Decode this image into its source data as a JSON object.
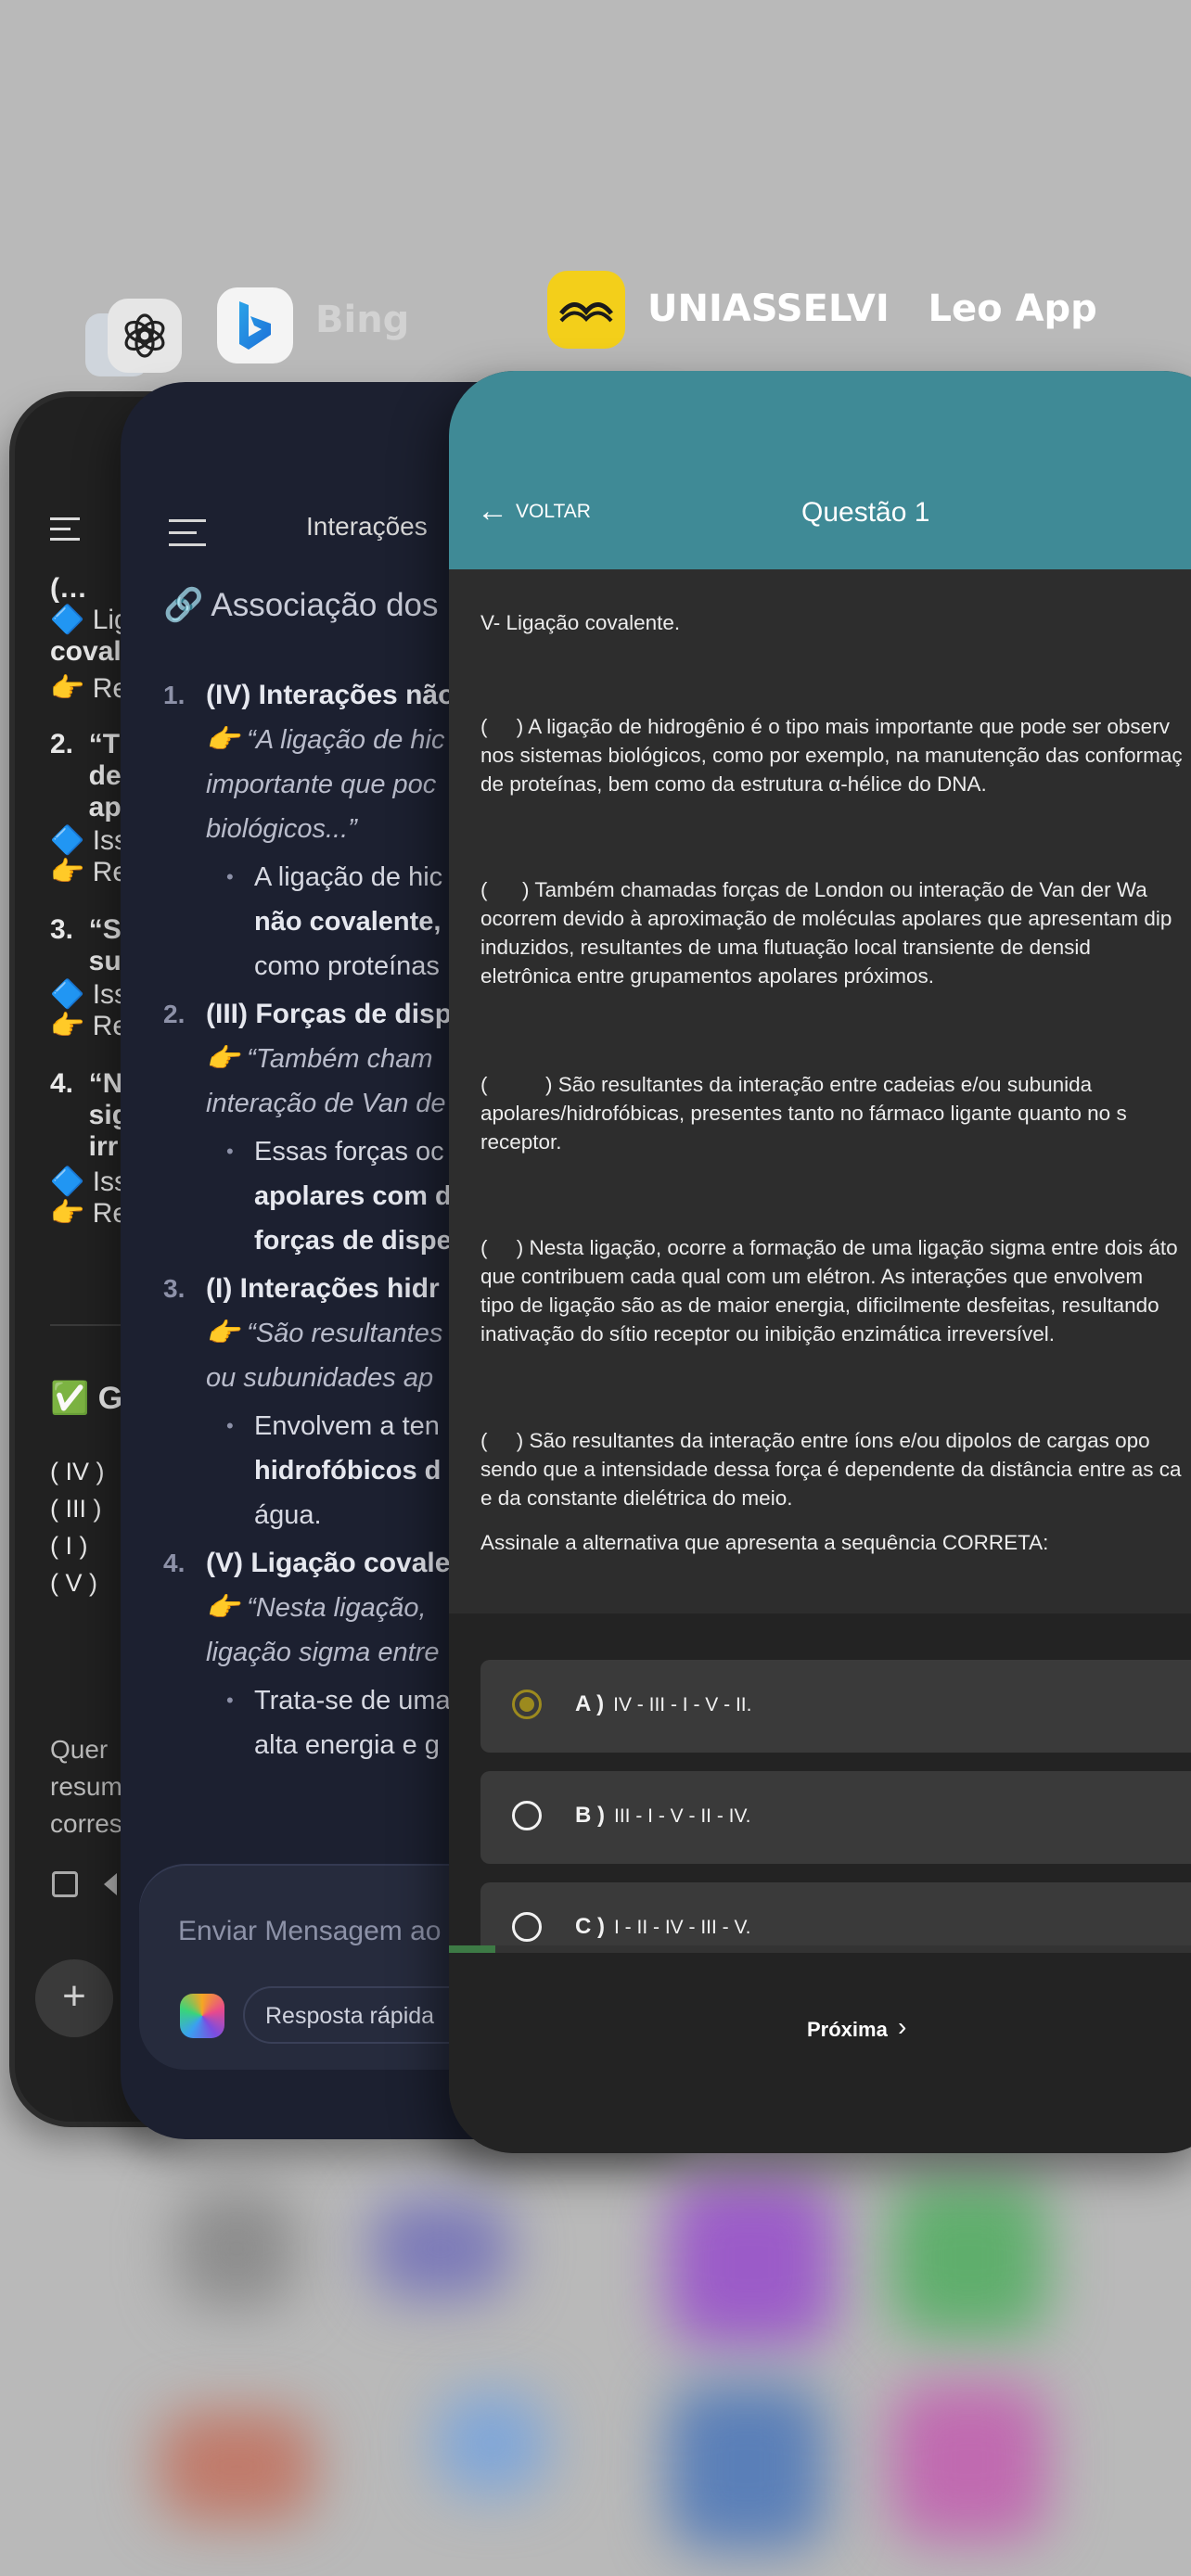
{
  "app_switcher": {
    "apps": [
      {
        "name": "",
        "icon": "chatgpt-icon"
      },
      {
        "name": "Bing",
        "icon": "bing-icon"
      },
      {
        "name": "UNIASSELVI   Leo App",
        "icon": "uniasselvi-logo-icon"
      }
    ]
  },
  "chatgpt": {
    "lines": [
      {
        "text": "(…",
        "bold": true
      },
      {
        "text": "🔷 Lig",
        "bold": false
      },
      {
        "text": "coval",
        "bold": true
      },
      {
        "text": "👉 Re",
        "bold": false
      },
      {
        "text": "2.  “T",
        "bold": true
      },
      {
        "text": "     de",
        "bold": true
      },
      {
        "text": "     ap",
        "bold": true
      },
      {
        "text": "🔷 Iss",
        "bold": false
      },
      {
        "text": "👉 Re",
        "bold": false
      },
      {
        "text": "3.  “S",
        "bold": true
      },
      {
        "text": "     su",
        "bold": true
      },
      {
        "text": "🔷 Iss",
        "bold": false
      },
      {
        "text": "👉 Re",
        "bold": false
      },
      {
        "text": "4.  “N",
        "bold": true
      },
      {
        "text": "     sig",
        "bold": true
      },
      {
        "text": "     irr",
        "bold": true
      },
      {
        "text": "🔷 Iss",
        "bold": false
      },
      {
        "text": "👉 Re",
        "bold": false
      }
    ],
    "section_title": "✅ G",
    "sequence": [
      "( IV )",
      "( III )",
      "( I )",
      "( V )"
    ],
    "footer_text": [
      "Quer",
      "resum",
      "corres"
    ]
  },
  "bing": {
    "header_title": "Interações",
    "section_title": "🔗 Associação dos",
    "items": [
      {
        "num": "1.",
        "head": "(IV) Interações não",
        "quote": [
          "👉 “A ligação de hic",
          "importante que poc",
          "biológicos...”"
        ],
        "bullet": [
          "A ligação de hic",
          "não covalente,",
          "como proteínas"
        ]
      },
      {
        "num": "2.",
        "head": "(III) Forças de disp",
        "quote": [
          "👉 “Também cham",
          "interação de Van de"
        ],
        "bullet": [
          "Essas forças oc",
          "apolares com d",
          "forças de dispe"
        ]
      },
      {
        "num": "3.",
        "head": "(I) Interações hidr",
        "quote": [
          "👉 “São resultantes",
          "ou subunidades ap"
        ],
        "bullet": [
          "Envolvem a ten",
          "hidrofóbicos d",
          "água."
        ]
      },
      {
        "num": "4.",
        "head": "(V) Ligação covale",
        "quote": [
          "👉 “Nesta ligação,",
          "ligação sigma entre"
        ],
        "bullet": [
          "Trata-se de uma",
          "alta energia e g"
        ]
      }
    ],
    "composer_placeholder": "Enviar Mensagem ao C",
    "quick_reply_label": "Resposta rápida"
  },
  "leo": {
    "back_label": "VOLTAR",
    "title": "Questão 1",
    "paragraphs": [
      [
        "V- Ligação covalente."
      ],
      [
        "(     ) A ligação de hidrogênio é o tipo mais importante que pode ser observ",
        "nos sistemas biológicos, como por exemplo, na manutenção das conformaç",
        "de proteínas, bem como da estrutura α-hélice do DNA."
      ],
      [
        "(      ) Também chamadas forças de London ou interação de Van der Wa",
        "ocorrem devido à aproximação de moléculas apolares que apresentam dip",
        "induzidos, resultantes de uma flutuação local transiente de densid",
        "eletrônica entre grupamentos apolares próximos."
      ],
      [
        "(          ) São resultantes da interação entre cadeias e/ou subunida",
        "apolares/hidrofóbicas, presentes tanto no fármaco ligante quanto no s",
        "receptor."
      ],
      [
        "(     ) Nesta ligação, ocorre a formação de uma ligação sigma entre dois áto",
        "que contribuem cada qual com um elétron. As interações que envolvem",
        "tipo de ligação são as de maior energia, dificilmente desfeitas, resultando",
        "inativação do sítio receptor ou inibição enzimática irreversível."
      ],
      [
        "(     ) São resultantes da interação entre íons e/ou dipolos de cargas opo",
        "sendo que a intensidade dessa força é dependente da distância entre as ca",
        "e da constante dielétrica do meio."
      ],
      [
        "Assinale a alternativa que apresenta a sequência CORRETA:"
      ]
    ],
    "options": [
      {
        "letter": "A )",
        "text": "IV - III - I - V - II.",
        "selected": true
      },
      {
        "letter": "B )",
        "text": "III - I - V - II - IV.",
        "selected": false
      },
      {
        "letter": "C )",
        "text": "I - II - IV - III - V.",
        "selected": false
      }
    ],
    "progress_fraction": 0.06,
    "next_label": "Próxima",
    "colors": {
      "header": "#3f8a96",
      "radio_selected": "#9c8a1e"
    }
  }
}
